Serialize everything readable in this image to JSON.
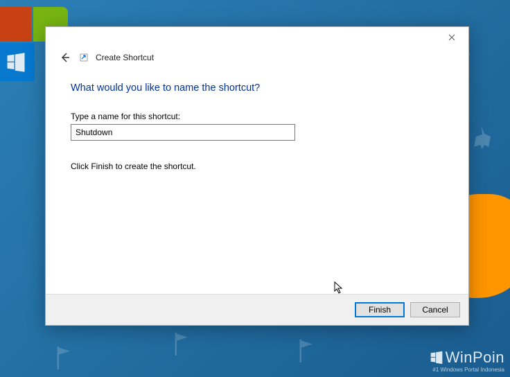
{
  "dialog": {
    "wizard_title": "Create Shortcut",
    "heading": "What would you like to name the shortcut?",
    "input_label": "Type a name for this shortcut:",
    "input_value": "Shutdown",
    "hint": "Click Finish to create the shortcut.",
    "buttons": {
      "finish": "Finish",
      "cancel": "Cancel"
    }
  },
  "watermark": {
    "brand": "WinPoin",
    "tagline": "#1 Windows Portal Indonesia"
  }
}
